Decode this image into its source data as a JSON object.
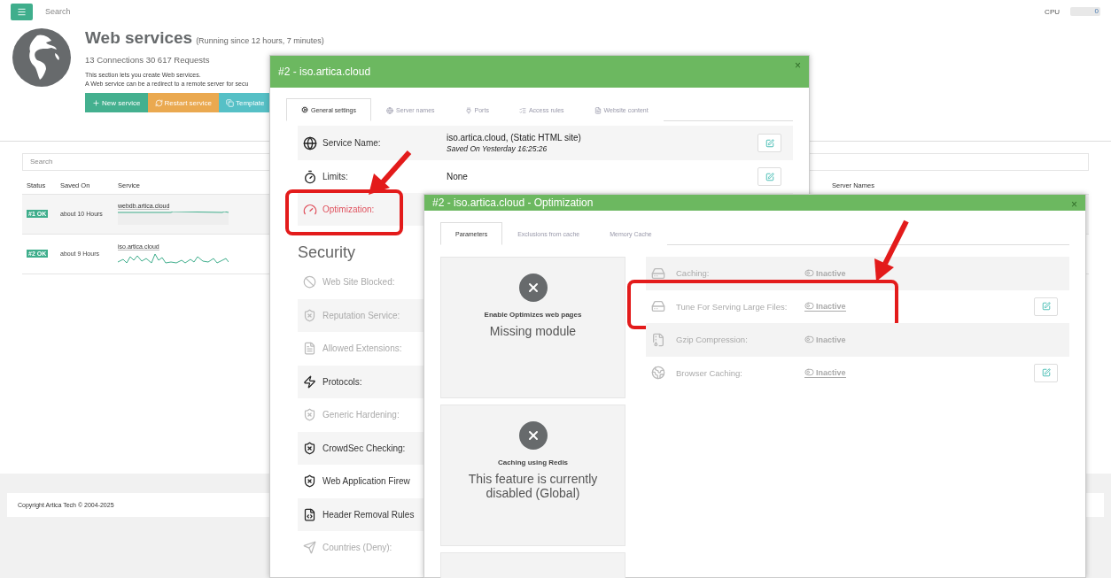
{
  "topbar": {
    "search_placeholder": "Search",
    "cpu_label": "CPU",
    "cpu_value": "0"
  },
  "header": {
    "title": "Web services",
    "subtitle": "(Running since 12 hours, 7 minutes)",
    "stats": "13 Connections 30 617 Requests",
    "description": [
      "This section lets you create Web services.",
      "A Web service can be a redirect to a remote server for secu"
    ],
    "buttons": [
      {
        "label": "New service",
        "kind": "new"
      },
      {
        "label": "Restart service",
        "kind": "restart"
      },
      {
        "label": "Template",
        "kind": "template"
      }
    ]
  },
  "table": {
    "search_placeholder": "Search",
    "columns": [
      "Status",
      "Saved On",
      "Service",
      "Server Names"
    ],
    "rows": [
      {
        "status": "#1 OK",
        "saved_on": "about 10 Hours",
        "service": "webdb.artica.cloud",
        "kind": "flat"
      },
      {
        "status": "#2 OK",
        "saved_on": "about 9 Hours",
        "service": "iso.artica.cloud",
        "kind": "wave"
      }
    ]
  },
  "footer": "Copyright Artica Tech © 2004-2025",
  "service_dialog": {
    "title": "#2 - iso.artica.cloud",
    "close": "×",
    "tabs": [
      {
        "label": "General settings",
        "kind": "cogs",
        "selected": true
      },
      {
        "label": "Server names",
        "kind": "globe",
        "selected": false
      },
      {
        "label": "Ports",
        "kind": "plug",
        "selected": false
      },
      {
        "label": "Access rules",
        "kind": "rules",
        "selected": false
      },
      {
        "label": "Website content",
        "kind": "file",
        "selected": false
      }
    ],
    "rows": [
      {
        "label": "Service Name:",
        "kind": "globe",
        "value": "iso.artica.cloud, (Static HTML site)",
        "note": "Saved On Yesterday 16:25:26",
        "editable": true,
        "warning": false,
        "highlighted": false
      },
      {
        "label": "Limits:",
        "kind": "timer",
        "value": "None",
        "editable": true,
        "warning": false,
        "highlighted": false
      },
      {
        "label": "Optimization:",
        "kind": "gauge",
        "editable": false,
        "warning": true,
        "highlighted": true
      }
    ],
    "section": "Security",
    "security_items": [
      {
        "label": "Web Site Blocked:",
        "kind": "ban",
        "disabled": true
      },
      {
        "label": "Reputation Service:",
        "kind": "shield",
        "disabled": true
      },
      {
        "label": "Allowed Extensions:",
        "kind": "file",
        "disabled": true
      },
      {
        "label": "Protocols:",
        "kind": "zap",
        "disabled": false
      },
      {
        "label": "Generic Hardening:",
        "kind": "shield",
        "disabled": true
      },
      {
        "label": "CrowdSec Checking:",
        "kind": "shield",
        "disabled": false
      },
      {
        "label": "Web Application Firew",
        "kind": "shield",
        "disabled": false
      },
      {
        "label": "Header Removal Rules",
        "kind": "code",
        "disabled": false
      },
      {
        "label": "Countries (Deny):",
        "kind": "send",
        "disabled": true
      }
    ]
  },
  "optimization_dialog": {
    "title": "#2 - iso.artica.cloud - Optimization",
    "close": "×",
    "tabs": [
      {
        "label": "Parameters",
        "selected": true
      },
      {
        "label": "Exclusions from cache",
        "selected": false
      },
      {
        "label": "Memory Cache",
        "selected": false
      }
    ],
    "cards": [
      {
        "caption": "Enable Optimizes web pages",
        "message": "Missing module"
      },
      {
        "caption": "Caching using Redis",
        "message": "This feature is currently disabled (Global)"
      }
    ],
    "settings": [
      {
        "label": "Caching:",
        "kind": "server",
        "status": "Inactive",
        "linked": false,
        "editable": false,
        "highlighted": false
      },
      {
        "label": "Tune For Serving Large Files:",
        "kind": "server",
        "status": "Inactive",
        "linked": true,
        "editable": true,
        "highlighted": true
      },
      {
        "label": "Gzip Compression:",
        "kind": "zip",
        "status": "Inactive",
        "linked": false,
        "editable": false,
        "highlighted": false
      },
      {
        "label": "Browser Caching:",
        "kind": "browser",
        "status": "Inactive",
        "linked": true,
        "editable": true,
        "highlighted": false
      }
    ]
  }
}
